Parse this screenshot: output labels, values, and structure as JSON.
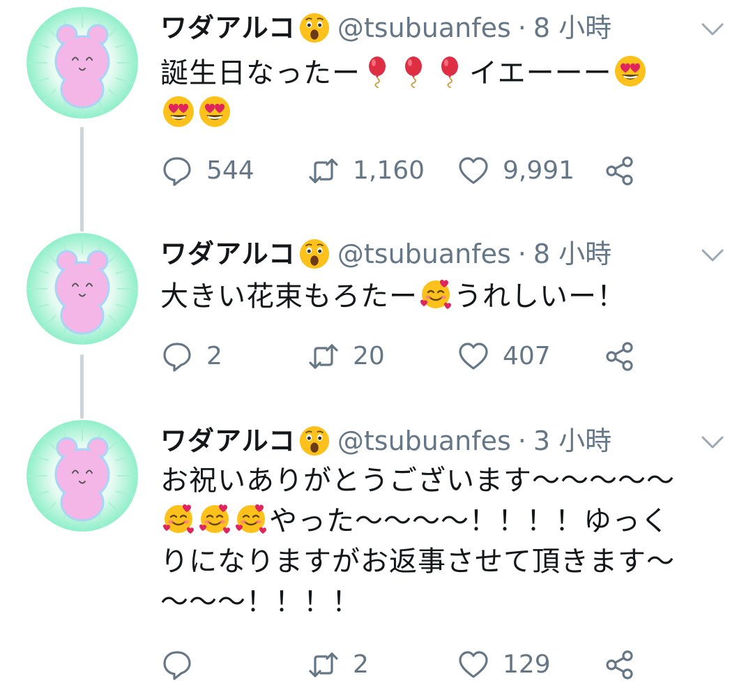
{
  "user": {
    "display_name": "ワダアルコ",
    "handle": "@tsubuanfes"
  },
  "colors": {
    "text": "#14171a",
    "secondary": "#657786",
    "thread_line": "#cdd5dc",
    "avatar_pink": "#f4b6e6",
    "avatar_mint": "#9ff2d2"
  },
  "tweets": [
    {
      "time": "8 小時",
      "lines": [
        "誕生日なったー",
        "イエーーー"
      ],
      "emoji_icons": [
        "balloon-emoji",
        "heart-eyes-emoji"
      ],
      "reply_count": "544",
      "retweet_count": "1,160",
      "like_count": "9,991"
    },
    {
      "time": "8 小時",
      "text_before": "大きい花束もろたー",
      "text_after": "うれしいー！",
      "emoji_icons": [
        "smiling-face-with-hearts-emoji"
      ],
      "reply_count": "2",
      "retweet_count": "20",
      "like_count": "407"
    },
    {
      "time": "3 小時",
      "line1": "お祝いありがとうございます〜〜〜〜〜",
      "line2_after": "やった〜〜〜〜！！！！ゆっく",
      "line3": "りになりますがお返事させて頂きます〜",
      "line4": "〜〜〜！！！！",
      "emoji_icons": [
        "smiling-face-with-hearts-emoji"
      ],
      "reply_count": "",
      "retweet_count": "2",
      "like_count": "129"
    }
  ],
  "separator": "·"
}
